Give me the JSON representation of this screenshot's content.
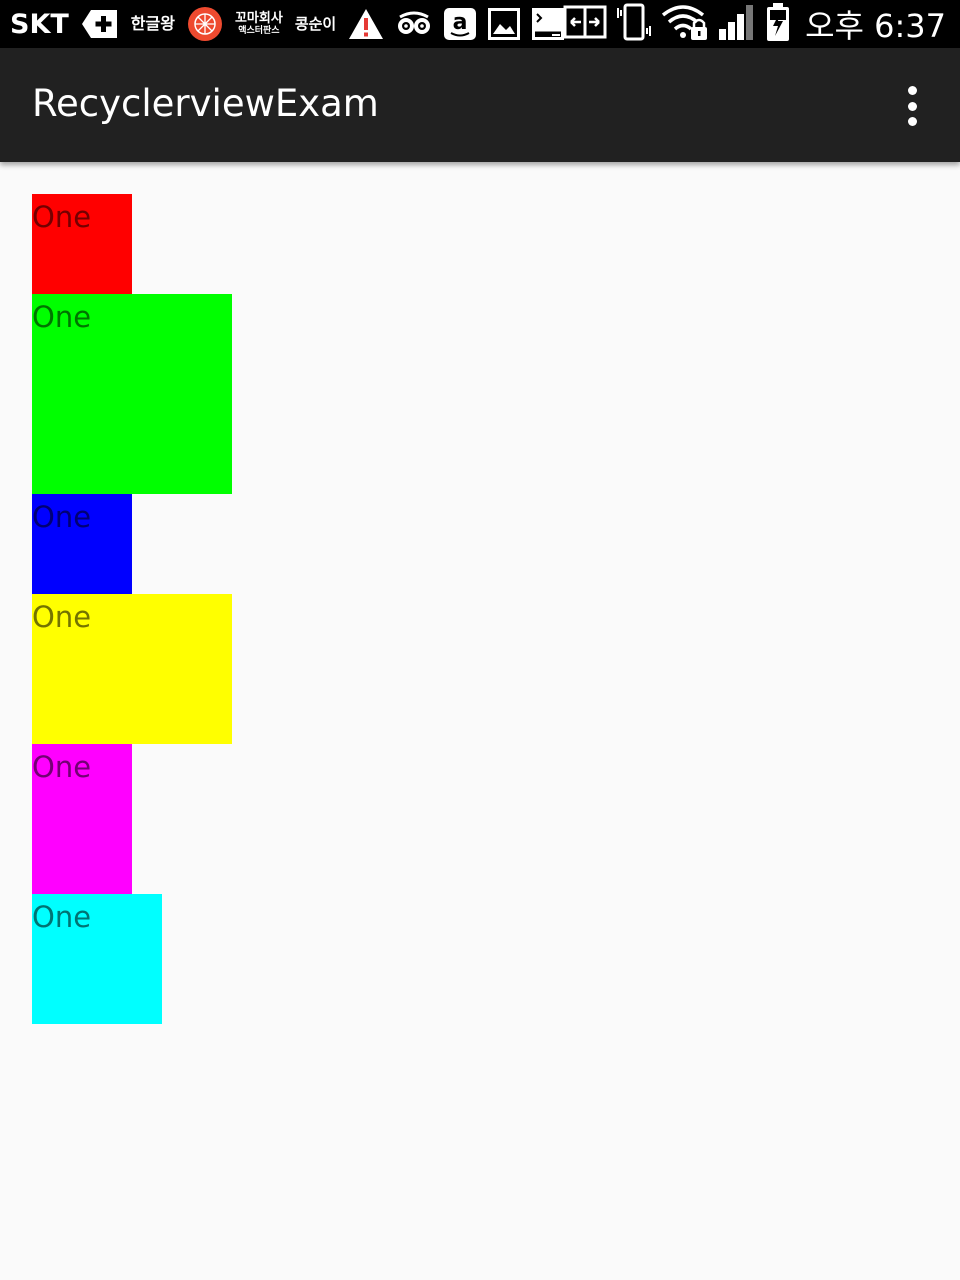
{
  "status_bar": {
    "carrier": "SKT",
    "notification_icons": [
      "medical-cross-icon",
      "hangul-app-icon",
      "red-globe-app-icon",
      "korean-app-icon",
      "korean-app-icon-2",
      "warning-icon",
      "tripadvisor-icon",
      "amazon-icon",
      "gallery-icon",
      "terminal-icon"
    ],
    "notification_texts": {
      "hangul": "한글왕",
      "kkoma_top": "꼬마회사",
      "kkoma_bottom": "액스터판스",
      "kong": "콩순이"
    },
    "system_icons": [
      "screen-mirror-icon",
      "vibrate-icon",
      "wifi-lock-icon",
      "signal-icon",
      "battery-charging-icon"
    ],
    "time": "오후 6:37"
  },
  "app_bar": {
    "title": "RecyclerviewExam",
    "menu_icon": "more-vert-icon"
  },
  "items": [
    {
      "label": "One",
      "color": "#ff0000"
    },
    {
      "label": "One",
      "color": "#00ff00"
    },
    {
      "label": "One",
      "color": "#0000ff"
    },
    {
      "label": "One",
      "color": "#ffff00"
    },
    {
      "label": "One",
      "color": "#ff00ff"
    },
    {
      "label": "One",
      "color": "#00ffff"
    }
  ]
}
